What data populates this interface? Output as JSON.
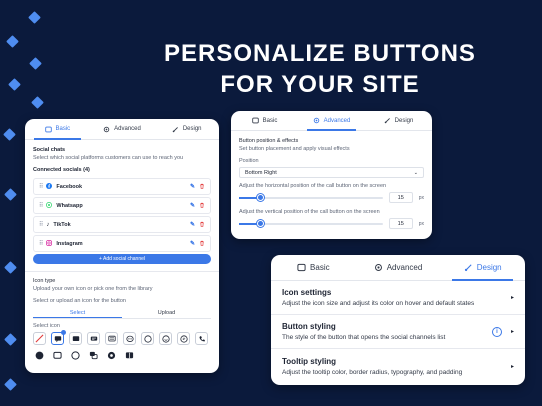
{
  "headline": {
    "line1": "PERSONALIZE BUTTONS",
    "line2": "FOR YOUR SITE"
  },
  "colors": {
    "background": "#0b1a3c",
    "accent": "#3b78e7",
    "delete": "#e23b3b",
    "diamond": "#4f8df0"
  },
  "tabs": {
    "basic": "Basic",
    "advanced": "Advanced",
    "design": "Design"
  },
  "panel_basic": {
    "social_chats_title": "Social chats",
    "social_chats_desc": "Select which social platforms customers can use to reach you",
    "connected_label": "Connected socials (4)",
    "socials": [
      {
        "name": "Facebook",
        "icon": "facebook-icon"
      },
      {
        "name": "Whatsapp",
        "icon": "whatsapp-icon"
      },
      {
        "name": "TikTok",
        "icon": "tiktok-icon"
      },
      {
        "name": "Instagram",
        "icon": "instagram-icon"
      }
    ],
    "add_button": "+ Add social channel",
    "icon_type_title": "Icon type",
    "icon_type_desc": "Upload your own icon or pick one from the library",
    "select_upload_label": "Select or upload an icon for the button",
    "seg_select": "Select",
    "seg_upload": "Upload",
    "select_icon_label": "Select icon"
  },
  "panel_advanced": {
    "title": "Button position & effects",
    "desc": "Set button placement and apply visual effects",
    "position_label": "Position",
    "position_value": "Bottom Right",
    "horizontal_label": "Adjust the horizontal position of the call button on the screen",
    "horizontal_value": "15",
    "vertical_label": "Adjust the vertical position of the call button on the screen",
    "vertical_value": "15",
    "unit": "px",
    "horizontal_fraction": 0.15,
    "vertical_fraction": 0.15
  },
  "panel_design": {
    "items": [
      {
        "title": "Icon settings",
        "desc": "Adjust the icon size and adjust its color on hover and default states"
      },
      {
        "title": "Button styling",
        "desc": "The style of the button that opens the social channels list"
      },
      {
        "title": "Tooltip styling",
        "desc": "Adjust the tooltip color, border radius, typography, and padding"
      }
    ]
  }
}
